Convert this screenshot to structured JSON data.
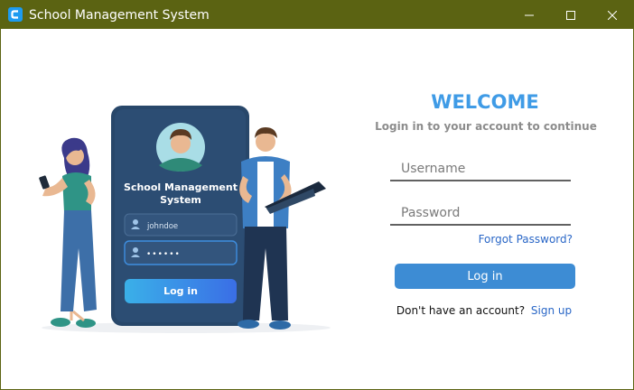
{
  "window": {
    "title": "School Management System",
    "controls": [
      "minimize-icon",
      "maximize-icon",
      "close-icon"
    ],
    "titlebar_color": "#5b6312"
  },
  "illustration": {
    "card_title": "School Management System",
    "card_username": "johndoe",
    "card_password_mask": "••••••",
    "card_login_label": "Log in"
  },
  "login": {
    "heading": "WELCOME",
    "subtitle": "Login in to your account to continue",
    "username_placeholder": "Username",
    "password_placeholder": "Password",
    "forgot_label": "Forgot Password?",
    "button_label": "Log in",
    "signup_question": "Don't have an account?",
    "signup_label": "Sign up",
    "accent_color": "#3f9be6",
    "button_color": "#3d8cd4"
  }
}
